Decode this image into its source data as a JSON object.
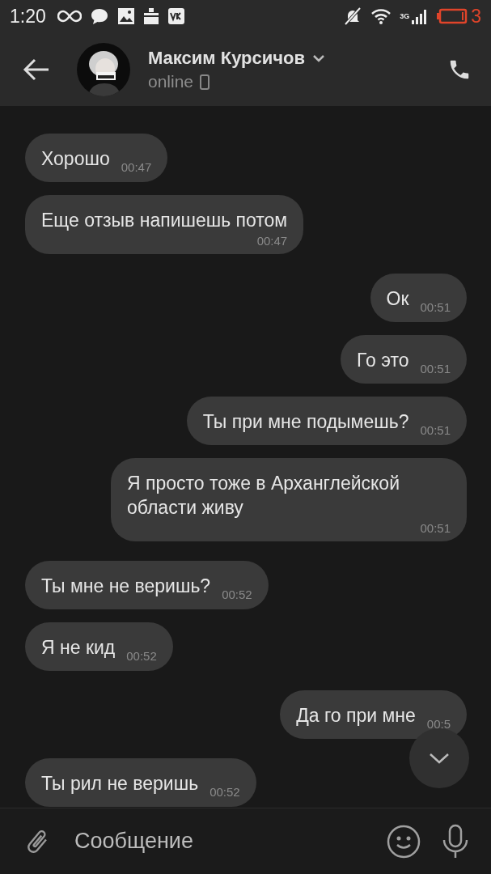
{
  "status_bar": {
    "time": "1:20",
    "network": "3G",
    "battery": "3"
  },
  "header": {
    "name": "Максим Курсичов",
    "presence": "online"
  },
  "messages": [
    {
      "outgoing": false,
      "kind": "inline",
      "text": "Хорошо",
      "time": "00:47"
    },
    {
      "outgoing": false,
      "kind": "stacked",
      "text": "Еще отзыв напишешь потом",
      "time": "00:47"
    },
    {
      "outgoing": true,
      "kind": "inline",
      "text": "Ок",
      "time": "00:51"
    },
    {
      "outgoing": true,
      "kind": "inline",
      "text": "Го это",
      "time": "00:51"
    },
    {
      "outgoing": true,
      "kind": "inline",
      "text": "Ты при мне подымешь?",
      "time": "00:51"
    },
    {
      "outgoing": true,
      "kind": "stacked",
      "text": "Я просто тоже в Арханглейской области живу",
      "time": "00:51"
    },
    {
      "outgoing": false,
      "kind": "inline",
      "text": "Ты мне не веришь?",
      "time": "00:52"
    },
    {
      "outgoing": false,
      "kind": "inline",
      "text": "Я не кид",
      "time": "00:52"
    },
    {
      "outgoing": true,
      "kind": "inline",
      "text": "Да го при мне",
      "time": "00:5"
    },
    {
      "outgoing": false,
      "kind": "inline",
      "text": "Ты рил не веришь",
      "time": "00:52"
    }
  ],
  "composer": {
    "placeholder": "Сообщение"
  }
}
